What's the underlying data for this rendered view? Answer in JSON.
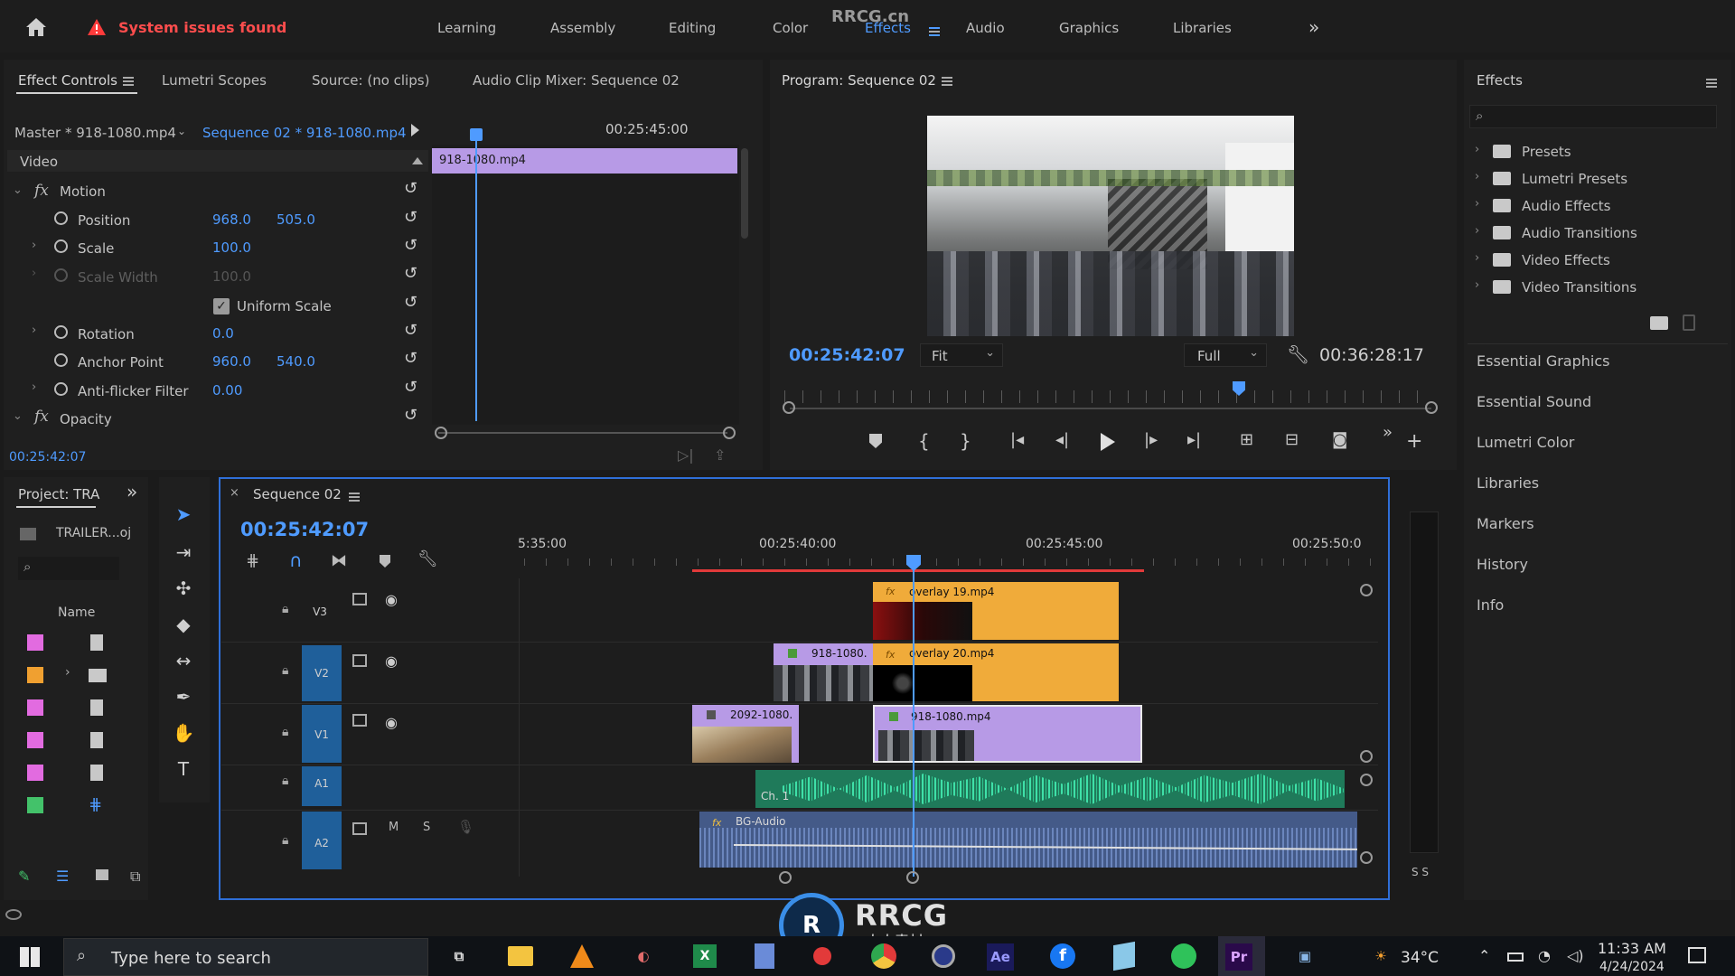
{
  "header": {
    "alert": "System issues found",
    "workspaces": [
      "Learning",
      "Assembly",
      "Editing",
      "Color",
      "Effects",
      "Audio",
      "Graphics",
      "Libraries"
    ],
    "active_workspace": "Effects",
    "watermark_top": "RRCG.cn"
  },
  "source_panel": {
    "tabs": [
      "Effect Controls",
      "Lumetri Scopes",
      "Source: (no clips)",
      "Audio Clip Mixer: Sequence 02"
    ],
    "master": "Master * 918-1080.mp4",
    "sequence": "Sequence 02 * 918-1080.mp4",
    "ruler_time": "00:25:45:00",
    "clip_label": "918-1080.mp4",
    "section_video": "Video",
    "motion": "Motion",
    "position_label": "Position",
    "position_x": "968.0",
    "position_y": "505.0",
    "scale_label": "Scale",
    "scale_val": "100.0",
    "scale_width_label": "Scale Width",
    "scale_width_val": "100.0",
    "uniform_scale": "Uniform Scale",
    "rotation_label": "Rotation",
    "rotation_val": "0.0",
    "anchor_label": "Anchor Point",
    "anchor_x": "960.0",
    "anchor_y": "540.0",
    "antiflicker_label": "Anti-flicker Filter",
    "antiflicker_val": "0.00",
    "opacity": "Opacity",
    "current_time": "00:25:42:07"
  },
  "program": {
    "title": "Program: Sequence 02",
    "timecode": "00:25:42:07",
    "fit": "Fit",
    "quality": "Full",
    "duration": "00:36:28:17"
  },
  "project": {
    "title": "Project: TRA",
    "file": "TRAILER...oj",
    "name_header": "Name",
    "swatches": [
      "#e26be0",
      "#f0a030",
      "#e26be0",
      "#e26be0",
      "#e26be0",
      "#43c26a"
    ]
  },
  "timeline": {
    "title": "Sequence 02",
    "timecode": "00:25:42:07",
    "ruler": [
      "5:35:00",
      "00:25:40:00",
      "00:25:45:00",
      "00:25:50:0"
    ],
    "tracks": [
      "V3",
      "V2",
      "V1",
      "A1",
      "A2"
    ],
    "clips": {
      "v3_overlay": "overlay 19.mp4",
      "v2_918": "918-1080.",
      "v2_overlay": "overlay 20.mp4",
      "v1_2092": "2092-1080.",
      "v1_918": "918-1080.mp4",
      "a1_ch": "Ch. 1",
      "a2_bg": "BG-Audio"
    },
    "audio_m": "M",
    "audio_s": "S",
    "meter_label": "S S"
  },
  "effects_panel": {
    "title": "Effects",
    "items": [
      "Presets",
      "Lumetri Presets",
      "Audio Effects",
      "Audio Transitions",
      "Video Effects",
      "Video Transitions"
    ],
    "links": [
      "Essential Graphics",
      "Essential Sound",
      "Lumetri Color",
      "Libraries",
      "Markers",
      "History",
      "Info"
    ]
  },
  "taskbar": {
    "search_placeholder": "Type here to search",
    "temperature": "34°C",
    "time": "11:33 AM",
    "date": "4/24/2024",
    "apps": [
      "Ae",
      "Pr"
    ]
  },
  "watermark": {
    "logo_text": "RRCG",
    "logo_sub": "人人素材"
  },
  "colors": {
    "accent": "#4f9bff",
    "alert_red": "#ff3b3b",
    "clip_orange": "#f0ab3a",
    "clip_purple": "#b79ae6",
    "audio_green": "#2fc28c",
    "audio_blue": "#5b7fc1",
    "playhead": "#4f9bff"
  }
}
